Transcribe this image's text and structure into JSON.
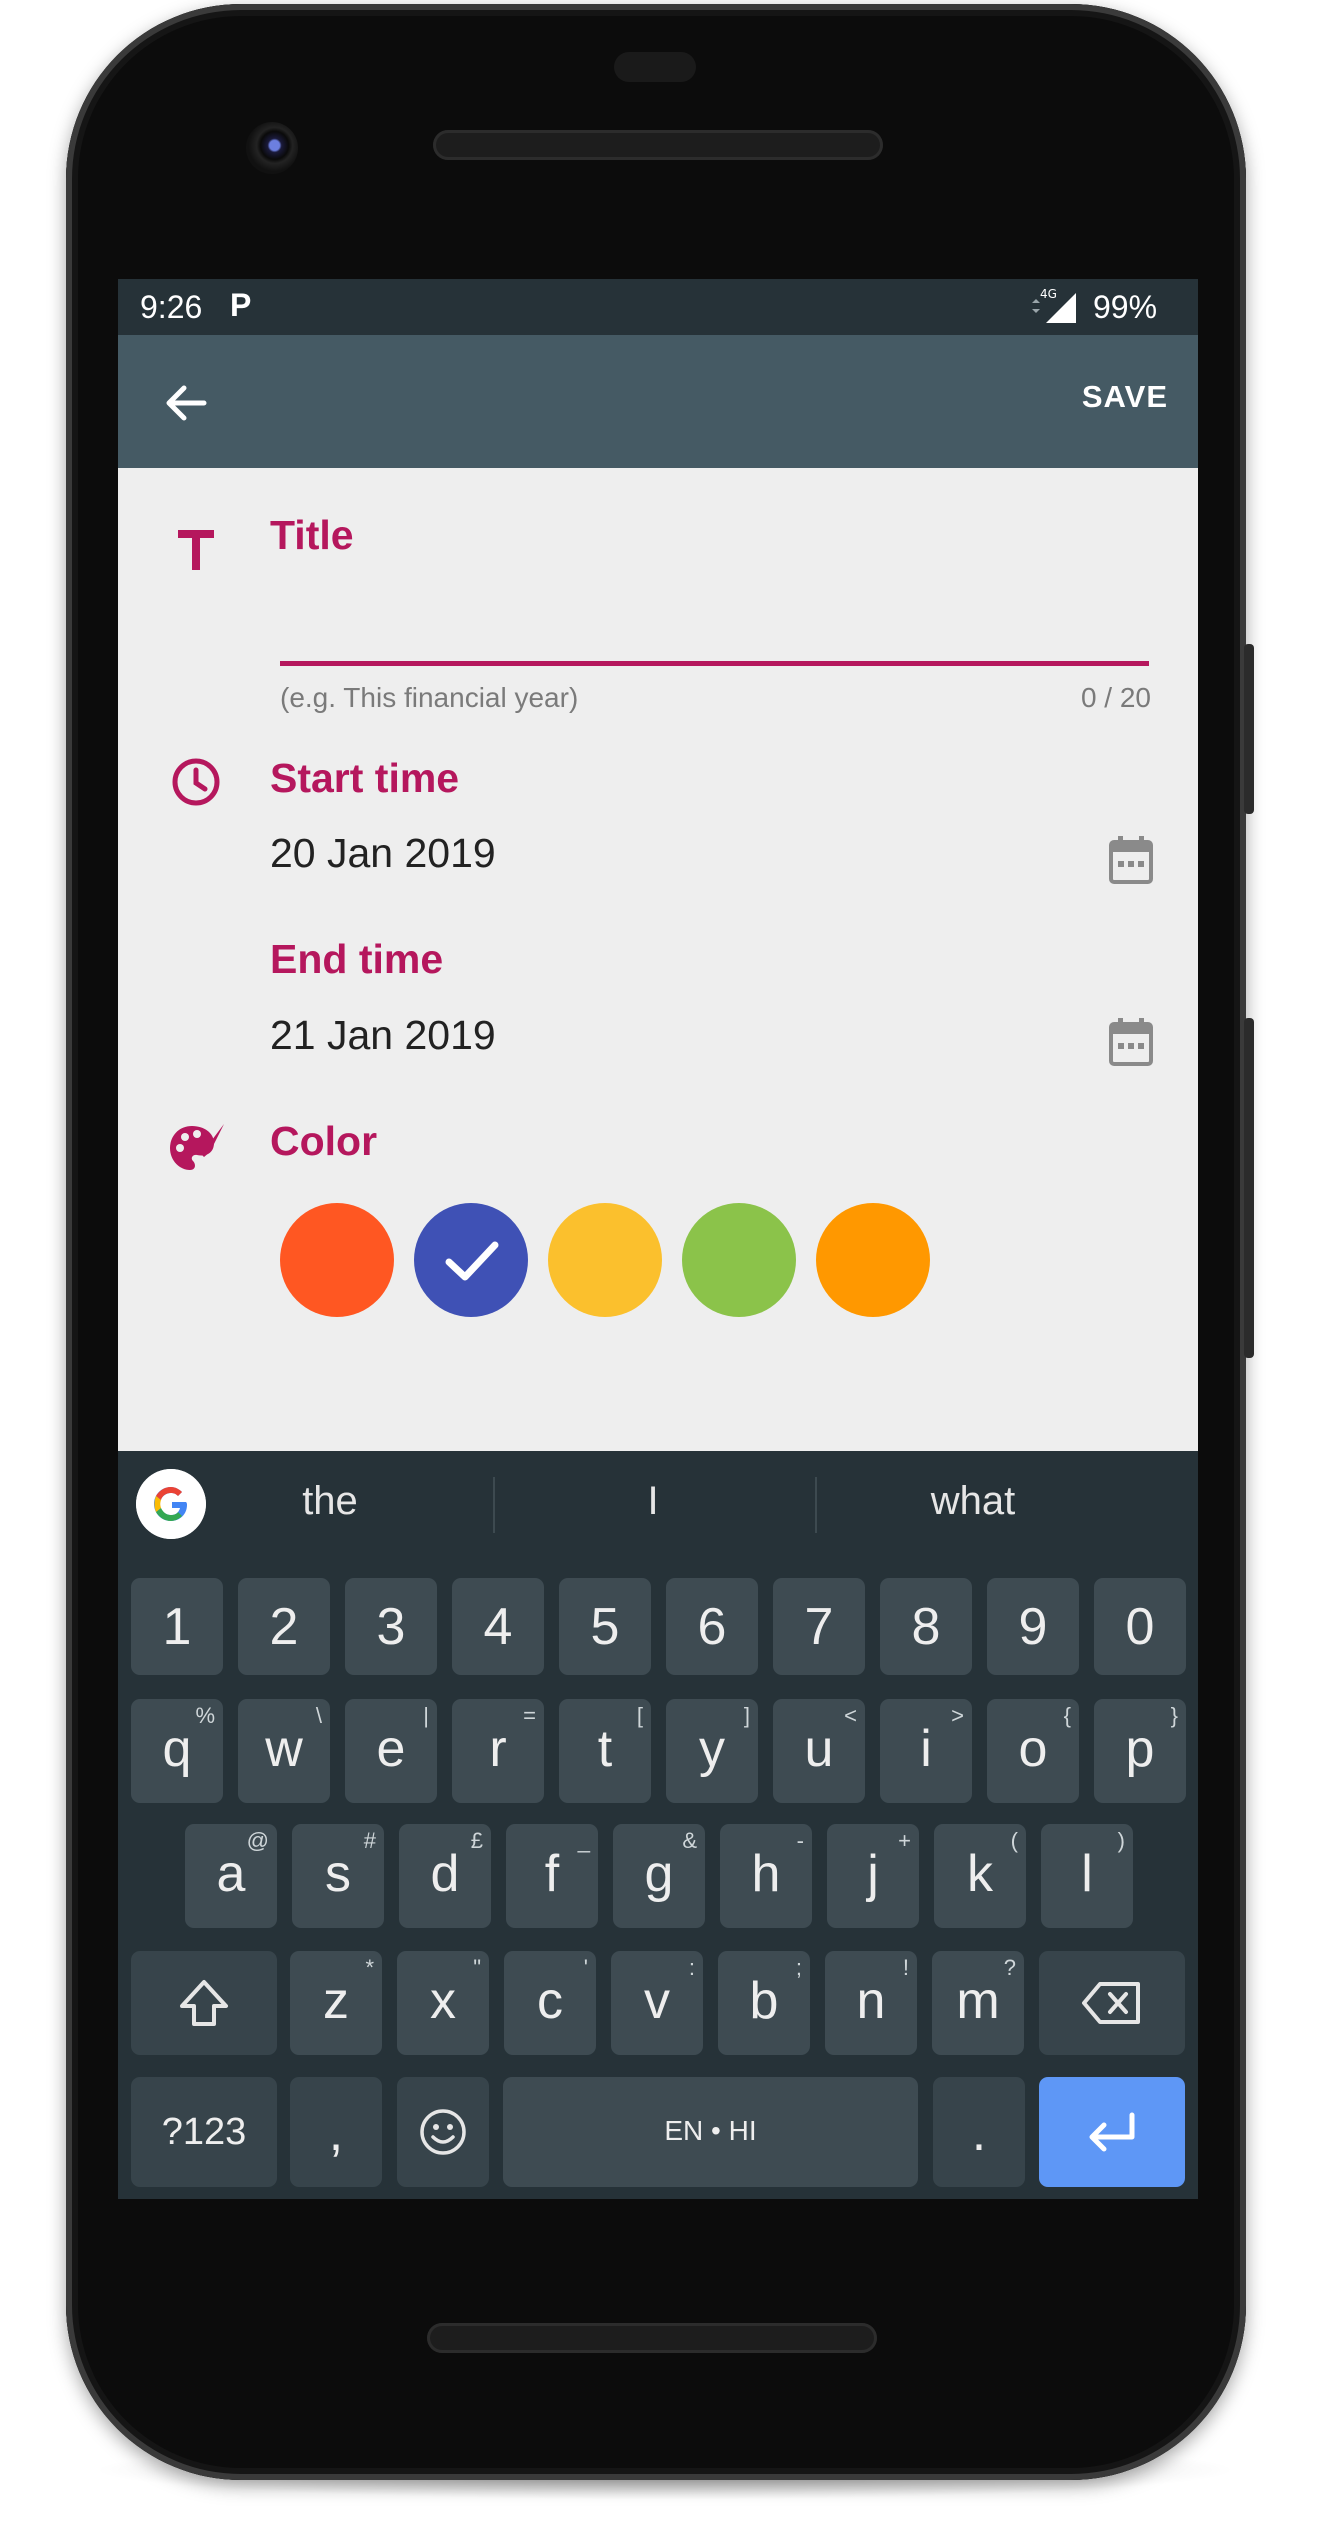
{
  "status_bar": {
    "time": "9:26",
    "app_badge": "P",
    "network": "4G",
    "battery": "99%"
  },
  "toolbar": {
    "save_label": "SAVE",
    "back_icon": "arrow-back-icon"
  },
  "form": {
    "title": {
      "label": "Title",
      "value": "",
      "placeholder": "",
      "helper": "(e.g. This financial year)",
      "counter": "0 / 20"
    },
    "start_time": {
      "label": "Start time",
      "value": "20 Jan 2019"
    },
    "end_time": {
      "label": "End time",
      "value": "21 Jan 2019"
    },
    "color": {
      "label": "Color",
      "swatches": [
        {
          "color": "#ff5722",
          "selected": false
        },
        {
          "color": "#3f51b5",
          "selected": true
        },
        {
          "color": "#fbc02d",
          "selected": false
        },
        {
          "color": "#8bc34a",
          "selected": false
        },
        {
          "color": "#ff9800",
          "selected": false
        }
      ]
    }
  },
  "keyboard": {
    "suggestions": [
      "the",
      "I",
      "what"
    ],
    "numbers": [
      "1",
      "2",
      "3",
      "4",
      "5",
      "6",
      "7",
      "8",
      "9",
      "0"
    ],
    "row1": [
      {
        "k": "q",
        "h": "%"
      },
      {
        "k": "w",
        "h": "\\"
      },
      {
        "k": "e",
        "h": "|"
      },
      {
        "k": "r",
        "h": "="
      },
      {
        "k": "t",
        "h": "["
      },
      {
        "k": "y",
        "h": "]"
      },
      {
        "k": "u",
        "h": "<"
      },
      {
        "k": "i",
        "h": ">"
      },
      {
        "k": "o",
        "h": "{"
      },
      {
        "k": "p",
        "h": "}"
      }
    ],
    "row2": [
      {
        "k": "a",
        "h": "@"
      },
      {
        "k": "s",
        "h": "#"
      },
      {
        "k": "d",
        "h": "£"
      },
      {
        "k": "f",
        "h": "_"
      },
      {
        "k": "g",
        "h": "&"
      },
      {
        "k": "h",
        "h": "-"
      },
      {
        "k": "j",
        "h": "+"
      },
      {
        "k": "k",
        "h": "("
      },
      {
        "k": "l",
        "h": ")"
      }
    ],
    "row3": [
      {
        "k": "z",
        "h": "*"
      },
      {
        "k": "x",
        "h": "\""
      },
      {
        "k": "c",
        "h": "'"
      },
      {
        "k": "v",
        "h": ":"
      },
      {
        "k": "b",
        "h": ";"
      },
      {
        "k": "n",
        "h": "!"
      },
      {
        "k": "m",
        "h": "?"
      }
    ],
    "symbols_key": "?123",
    "comma_key": ",",
    "space_label": "EN • HI",
    "period_key": ".",
    "accent_color": "#5e97f6"
  }
}
